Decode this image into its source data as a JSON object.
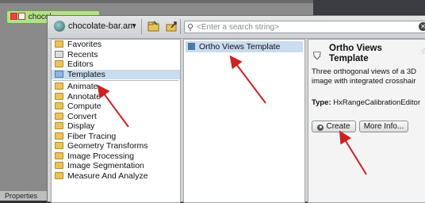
{
  "background": {
    "node_label": "chocol",
    "properties_tab": "Properties"
  },
  "toolbar": {
    "project_name": "chocolate-bar.am",
    "project_caret": "▾",
    "search_placeholder": "<Enter a search string>"
  },
  "categories": {
    "top": [
      {
        "label": "Favorites",
        "icon": "favorites-folder-icon"
      },
      {
        "label": "Recents",
        "icon": "recents-icon"
      },
      {
        "label": "Editors",
        "icon": "editors-folder-icon"
      },
      {
        "label": "Templates",
        "icon": "templates-folder-icon",
        "selected": true
      }
    ],
    "groups": [
      "Animate",
      "Annotate",
      "Compute",
      "Convert",
      "Display",
      "Fiber Tracing",
      "Geometry Transforms",
      "Image Processing",
      "Image Segmentation",
      "Measure And Analyze"
    ]
  },
  "list": {
    "items": [
      "Ortho Views Template"
    ]
  },
  "detail": {
    "title": "Ortho Views Template",
    "description": "Three orthogonal views of a 3D image with integrated crosshair",
    "type_label": "Type:",
    "type_value": "HxRangeCalibrationEditor",
    "create_label": "Create",
    "more_info_label": "More Info..."
  },
  "colors": {
    "annotation_arrow": "#cc2222",
    "selection": "#c9dcf0",
    "node_chip": "#b4e08a"
  }
}
